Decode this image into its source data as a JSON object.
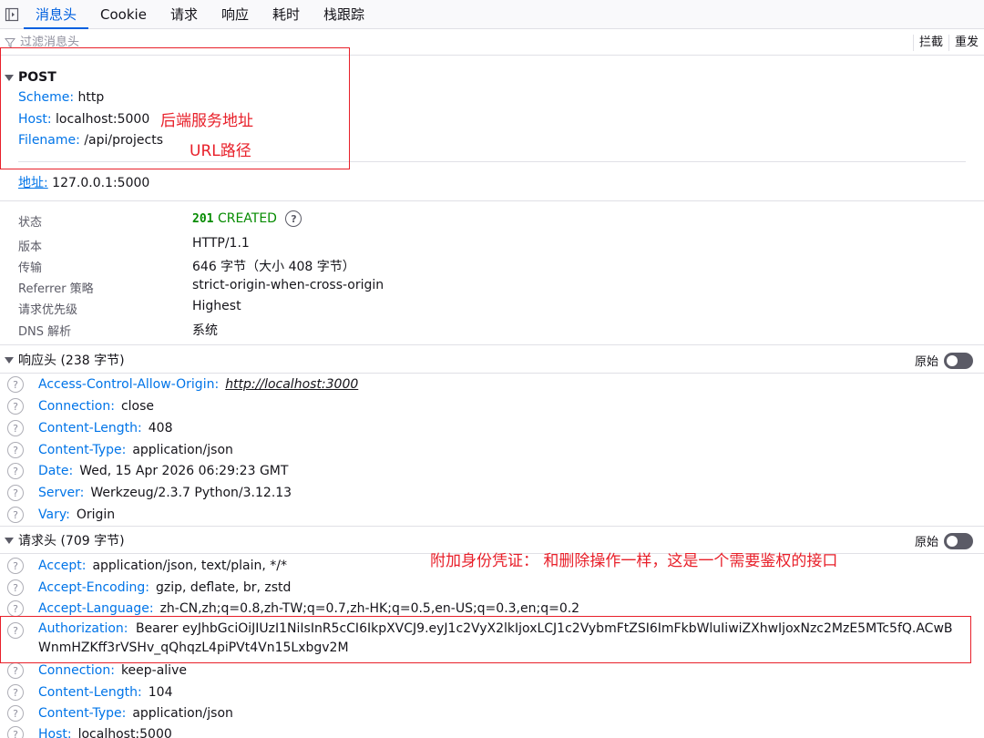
{
  "tabs": [
    {
      "label": "消息头",
      "active": true
    },
    {
      "label": "Cookie"
    },
    {
      "label": "请求"
    },
    {
      "label": "响应"
    },
    {
      "label": "耗时"
    },
    {
      "label": "栈跟踪"
    }
  ],
  "filter": {
    "placeholder": "过滤消息头",
    "block_label": "拦截",
    "resend_label": "重发"
  },
  "request": {
    "method": "POST",
    "scheme": {
      "label": "Scheme:",
      "value": "http"
    },
    "host": {
      "label": "Host:",
      "value": "localhost:5000"
    },
    "filename": {
      "label": "Filename:",
      "value": "/api/projects"
    },
    "address": {
      "label": "地址:",
      "value": "127.0.0.1:5000"
    }
  },
  "summary": {
    "status": {
      "label": "状态",
      "code": "201",
      "text": "CREATED"
    },
    "version": {
      "label": "版本",
      "value": "HTTP/1.1"
    },
    "transfer": {
      "label": "传输",
      "value": "646 字节（大小 408 字节）"
    },
    "referrer": {
      "label": "Referrer 策略",
      "value": "strict-origin-when-cross-origin"
    },
    "priority": {
      "label": "请求优先级",
      "value": "Highest"
    },
    "dns": {
      "label": "DNS 解析",
      "value": "系统"
    }
  },
  "response_headers": {
    "title": "响应头 (238 字节)",
    "raw_label": "原始",
    "items": [
      {
        "name": "Access-Control-Allow-Origin:",
        "value": "http://localhost:3000"
      },
      {
        "name": "Connection:",
        "value": "close"
      },
      {
        "name": "Content-Length:",
        "value": "408"
      },
      {
        "name": "Content-Type:",
        "value": "application/json"
      },
      {
        "name": "Date:",
        "value": "Wed, 15 Apr 2026 06:29:23 GMT"
      },
      {
        "name": "Server:",
        "value": "Werkzeug/2.3.7 Python/3.12.13"
      },
      {
        "name": "Vary:",
        "value": "Origin"
      }
    ]
  },
  "request_headers": {
    "title": "请求头 (709 字节)",
    "raw_label": "原始",
    "items": [
      {
        "name": "Accept:",
        "value": "application/json, text/plain, */*"
      },
      {
        "name": "Accept-Encoding:",
        "value": "gzip, deflate, br, zstd"
      },
      {
        "name": "Accept-Language:",
        "value": "zh-CN,zh;q=0.8,zh-TW;q=0.7,zh-HK;q=0.5,en-US;q=0.3,en;q=0.2"
      },
      {
        "name": "Authorization:",
        "value": "Bearer eyJhbGciOiJIUzI1NiIsInR5cCI6IkpXVCJ9.eyJ1c2VyX2lkIjoxLCJ1c2VybmFtZSI6ImFkbWluIiwiZXhwIjoxNzc2MzE5MTc5fQ.ACwBWnmHZKff3rVSHv_qQhqzL4piPVt4Vn15Lxbgv2M"
      },
      {
        "name": "Connection:",
        "value": "keep-alive"
      },
      {
        "name": "Content-Length:",
        "value": "104"
      },
      {
        "name": "Content-Type:",
        "value": "application/json"
      },
      {
        "name": "Host:",
        "value": "localhost:5000"
      }
    ]
  },
  "annotations": {
    "backend_address": "后端服务地址",
    "url_path": "URL路径",
    "auth_note": "附加身份凭证： 和删除操作一样，这是一个需要鉴权的接口"
  },
  "colors": {
    "accent": "#0060df",
    "header_name": "#0074e8",
    "status_ok": "#058b00",
    "annotation": "#e8202a"
  }
}
